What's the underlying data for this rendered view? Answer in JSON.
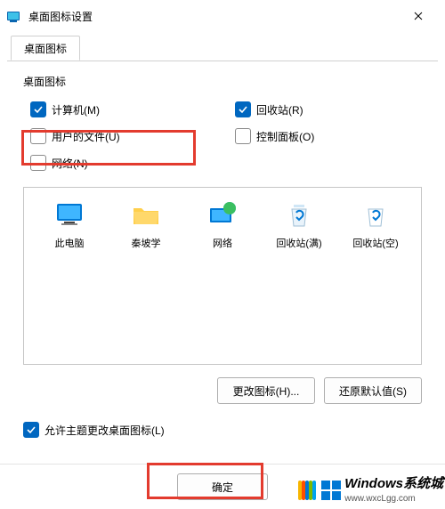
{
  "window": {
    "title": "桌面图标设置"
  },
  "tabs": [
    {
      "label": "桌面图标"
    }
  ],
  "group": {
    "label": "桌面图标"
  },
  "checkboxes": {
    "computer": {
      "label": "计算机(M)",
      "checked": true
    },
    "recycle": {
      "label": "回收站(R)",
      "checked": true
    },
    "user_files": {
      "label": "用户的文件(U)",
      "checked": false
    },
    "control_panel": {
      "label": "控制面板(O)",
      "checked": false
    },
    "network": {
      "label": "网络(N)",
      "checked": false
    },
    "allow_themes": {
      "label": "允许主题更改桌面图标(L)",
      "checked": true
    }
  },
  "icons": [
    {
      "name": "this-pc",
      "label": "此电脑"
    },
    {
      "name": "user-folder",
      "label": "秦坡学"
    },
    {
      "name": "network",
      "label": "网络"
    },
    {
      "name": "recycle-full",
      "label": "回收站(满)"
    },
    {
      "name": "recycle-empty",
      "label": "回收站(空)"
    }
  ],
  "buttons": {
    "change_icon": "更改图标(H)...",
    "restore_default": "还原默认值(S)",
    "ok": "确定"
  },
  "watermark": {
    "title": "Windows系统城",
    "url": "www.wxcLgg.com"
  },
  "colors": {
    "accent": "#0067c0",
    "highlight": "#e33b2e"
  }
}
